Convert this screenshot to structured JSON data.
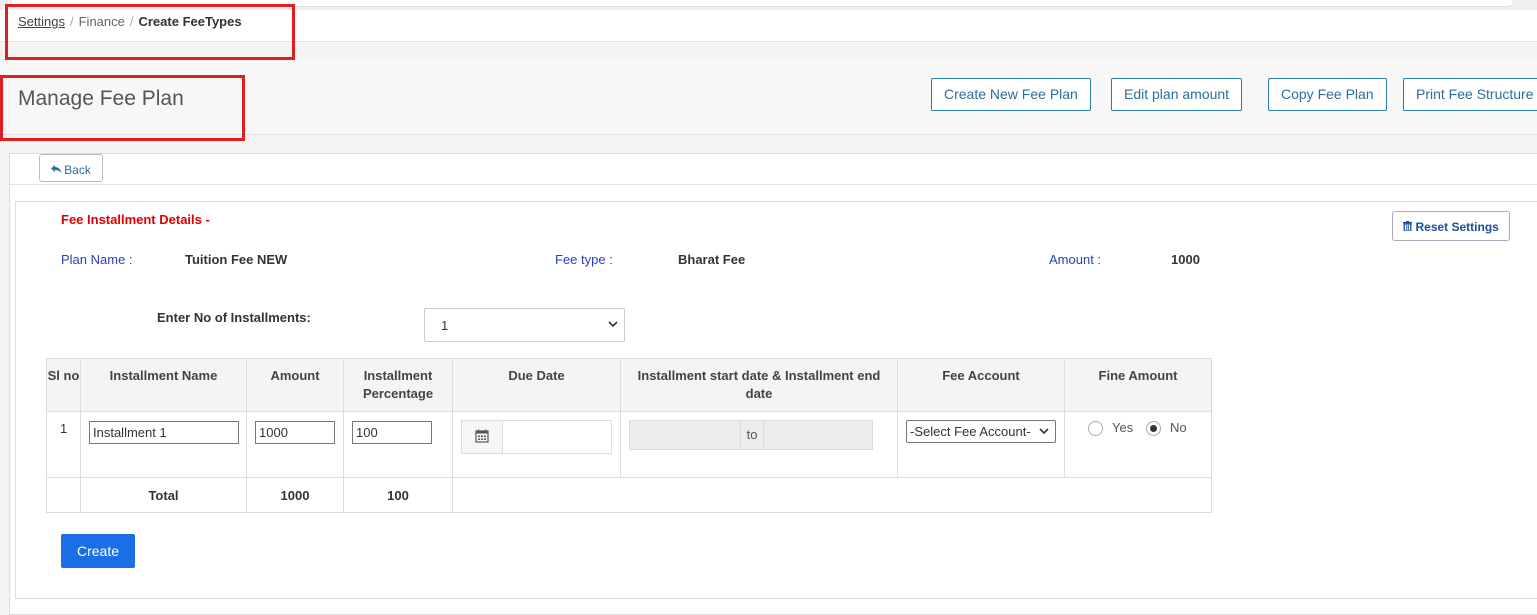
{
  "breadcrumb": {
    "root": "Settings",
    "middle": "Finance",
    "current": "Create FeeTypes",
    "separator": "/"
  },
  "page": {
    "title": "Manage Fee Plan"
  },
  "header_buttons": {
    "create_new": "Create New Fee Plan",
    "edit_amount": "Edit plan amount",
    "copy": "Copy Fee Plan",
    "print": "Print Fee Structure"
  },
  "back_label": "Back",
  "section": {
    "title": "Fee Installment Details -",
    "reset_label": "Reset Settings"
  },
  "plan": {
    "plan_name_label": "Plan Name :",
    "plan_name": "Tuition Fee NEW",
    "fee_type_label": "Fee type :",
    "fee_type": "Bharat Fee",
    "amount_label": "Amount :",
    "amount": "1000"
  },
  "installments": {
    "label": "Enter No of Installments:",
    "selected": "1"
  },
  "table": {
    "headers": {
      "slno": "Sl no",
      "name": "Installment Name",
      "amount": "Amount",
      "percentage": "Installment Percentage",
      "due_date": "Due Date",
      "range": "Installment start date & Installment end date",
      "account": "Fee Account",
      "fine": "Fine Amount"
    },
    "rows": [
      {
        "slno": "1",
        "name": "Installment 1",
        "amount": "1000",
        "percentage": "100",
        "due_date": "",
        "range_separator": "to",
        "account": "-Select Fee Account-",
        "fine_yes": "Yes",
        "fine_no": "No",
        "fine_selected": "No"
      }
    ],
    "total": {
      "label": "Total",
      "amount": "1000",
      "percentage": "100"
    }
  },
  "create_label": "Create",
  "icons": {
    "back": "reply-arrow-icon",
    "reset": "trash-icon",
    "calendar": "calendar-icon",
    "dropdown": "chevron-down-icon"
  },
  "colors": {
    "accent": "#1a6ee6",
    "section_title": "#e00000",
    "label": "#2a3fc0",
    "annotation": "#e02020"
  }
}
